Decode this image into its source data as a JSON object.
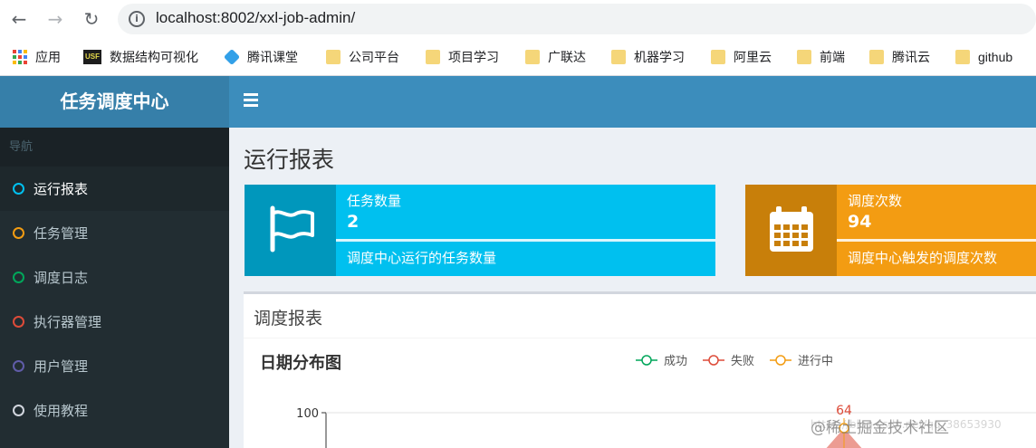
{
  "browser": {
    "url": "localhost:8002/xxl-job-admin/",
    "bookmarks": [
      {
        "label": "应用",
        "icon": "apps-grid-icon"
      },
      {
        "label": "数据结构可视化",
        "icon": "usf-icon",
        "badge": "USF"
      },
      {
        "label": "腾讯课堂",
        "icon": "tencent-classroom-icon"
      },
      {
        "label": "公司平台",
        "icon": "folder-icon"
      },
      {
        "label": "项目学习",
        "icon": "folder-icon"
      },
      {
        "label": "广联达",
        "icon": "folder-icon"
      },
      {
        "label": "机器学习",
        "icon": "folder-icon"
      },
      {
        "label": "阿里云",
        "icon": "folder-icon"
      },
      {
        "label": "前端",
        "icon": "folder-icon"
      },
      {
        "label": "腾讯云",
        "icon": "folder-icon"
      },
      {
        "label": "github",
        "icon": "folder-icon"
      }
    ]
  },
  "app": {
    "logo": "任务调度中心"
  },
  "sidebar": {
    "header": "导航",
    "items": [
      {
        "label": "运行报表",
        "color": "#00c0ef",
        "active": true
      },
      {
        "label": "任务管理",
        "color": "#f39c12",
        "active": false
      },
      {
        "label": "调度日志",
        "color": "#00a65a",
        "active": false
      },
      {
        "label": "执行器管理",
        "color": "#dd4b39",
        "active": false
      },
      {
        "label": "用户管理",
        "color": "#605ca8",
        "active": false
      },
      {
        "label": "使用教程",
        "color": "#d2d6de",
        "active": false
      }
    ]
  },
  "main": {
    "title": "运行报表",
    "cards": [
      {
        "label": "任务数量",
        "value": "2",
        "desc": "调度中心运行的任务数量",
        "color": "#00c0ef",
        "icon_bg": "#0097bc",
        "icon": "flag-icon"
      },
      {
        "label": "调度次数",
        "value": "94",
        "desc": "调度中心触发的调度次数",
        "color": "#f39c12",
        "icon_bg": "#c87f0a",
        "icon": "calendar-icon"
      }
    ],
    "report_box_title": "调度报表"
  },
  "chart_data": {
    "type": "line",
    "title": "日期分布图",
    "series": [
      {
        "name": "成功",
        "color": "#00a65a"
      },
      {
        "name": "失败",
        "color": "#dd4b39"
      },
      {
        "name": "进行中",
        "color": "#f39c12"
      }
    ],
    "y_ticks": [
      "100"
    ],
    "visible_label": "64",
    "ylim": [
      0,
      100
    ]
  },
  "watermark": {
    "text": "@稀土掘金技术社区",
    "faint": "https://blog.csdn.net/qq_38653930"
  }
}
